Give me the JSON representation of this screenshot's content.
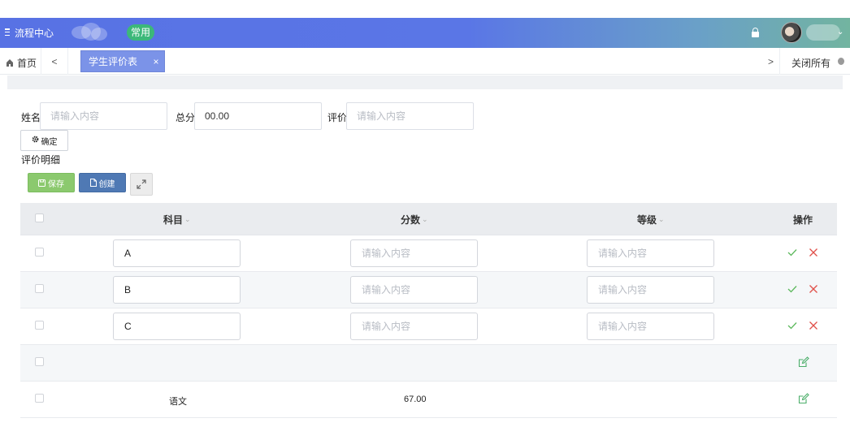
{
  "header": {
    "title": "流程中心",
    "badge": "常用",
    "icons": [
      "menu-icon",
      "lock-icon",
      "avatar",
      "chevron-down-icon"
    ]
  },
  "tabs": {
    "home_label": "首页",
    "prev_symbol": "<",
    "next_symbol": ">",
    "active_tab": "学生评价表",
    "close_symbol": "×",
    "close_all_label": "关闭所有"
  },
  "form": {
    "name_label": "姓名",
    "name_placeholder": "请输入内容",
    "name_value": "",
    "total_label": "总分",
    "total_value": "00.00",
    "eval_label": "评价",
    "eval_placeholder": "请输入内容",
    "eval_value": "",
    "confirm_label": "确定"
  },
  "details": {
    "section_title": "评价明细",
    "save_label": "保存",
    "create_label": "创建",
    "columns": {
      "subject": "科目",
      "score": "分数",
      "grade": "等级",
      "actions": "操作"
    },
    "placeholder": "请输入内容",
    "edit_rows": [
      {
        "subject": "A",
        "score": "",
        "grade": ""
      },
      {
        "subject": "B",
        "score": "",
        "grade": ""
      },
      {
        "subject": "C",
        "score": "",
        "grade": ""
      }
    ],
    "data_rows": [
      {
        "subject": "",
        "score": "",
        "grade": ""
      },
      {
        "subject": "语文",
        "score": "67.00",
        "grade": ""
      }
    ]
  },
  "colors": {
    "header_start": "#5872e4",
    "header_end": "#72b4a0",
    "badge": "#3cb879",
    "active_tab": "#7b93e8",
    "save_button": "#8bc96e",
    "create_button": "#4f79b4",
    "confirm_icon": "#5cb85c",
    "cancel_icon": "#e0504a"
  }
}
